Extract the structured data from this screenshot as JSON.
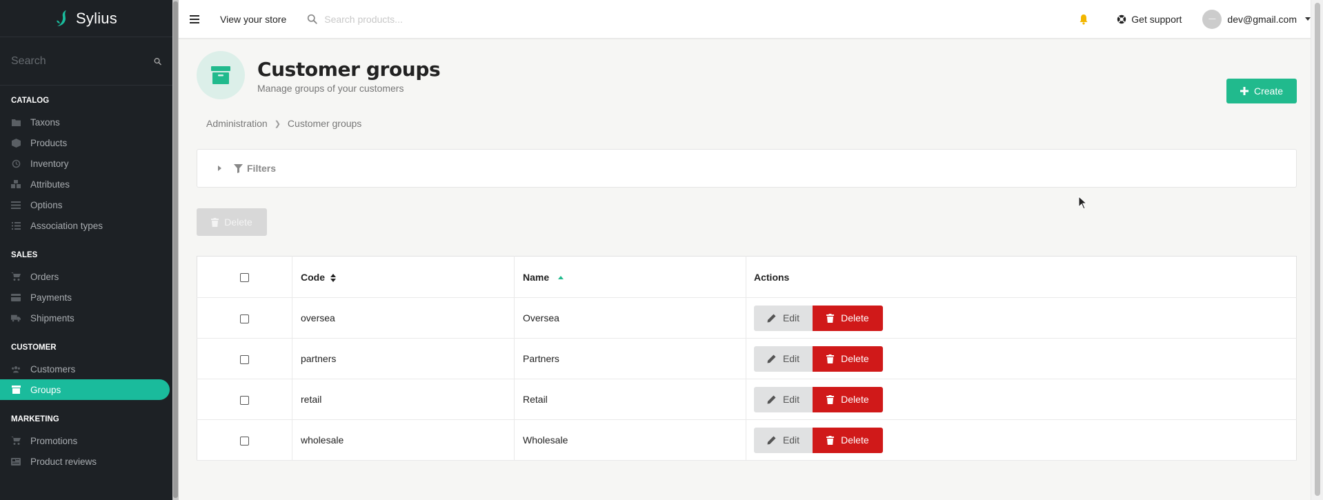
{
  "brand": {
    "name": "Sylius",
    "accent_color": "#1abb9c"
  },
  "sidebar": {
    "search_placeholder": "Search",
    "sections": [
      {
        "title": "CATALOG",
        "items": [
          {
            "label": "Taxons",
            "icon": "folder-icon"
          },
          {
            "label": "Products",
            "icon": "cube-icon"
          },
          {
            "label": "Inventory",
            "icon": "history-icon"
          },
          {
            "label": "Attributes",
            "icon": "cubes-icon"
          },
          {
            "label": "Options",
            "icon": "options-icon"
          },
          {
            "label": "Association types",
            "icon": "list-icon"
          }
        ]
      },
      {
        "title": "SALES",
        "items": [
          {
            "label": "Orders",
            "icon": "cart-icon"
          },
          {
            "label": "Payments",
            "icon": "payment-icon"
          },
          {
            "label": "Shipments",
            "icon": "truck-icon"
          }
        ]
      },
      {
        "title": "CUSTOMER",
        "items": [
          {
            "label": "Customers",
            "icon": "users-icon"
          },
          {
            "label": "Groups",
            "icon": "archive-icon",
            "active": true
          }
        ]
      },
      {
        "title": "MARKETING",
        "items": [
          {
            "label": "Promotions",
            "icon": "cart-icon"
          },
          {
            "label": "Product reviews",
            "icon": "newspaper-icon"
          }
        ]
      }
    ]
  },
  "topbar": {
    "view_store": "View your store",
    "search_placeholder": "Search products...",
    "support": "Get support",
    "user_email": "dev@gmail.com",
    "avatar_text": "—"
  },
  "page": {
    "title": "Customer groups",
    "subtitle": "Manage groups of your customers",
    "create_label": "Create",
    "breadcrumb": [
      "Administration",
      "Customer groups"
    ],
    "filters_label": "Filters",
    "bulk_delete_label": "Delete"
  },
  "table": {
    "headers": {
      "code": "Code",
      "name": "Name",
      "actions": "Actions"
    },
    "edit_label": "Edit",
    "delete_label": "Delete",
    "rows": [
      {
        "code": "oversea",
        "name": "Oversea"
      },
      {
        "code": "partners",
        "name": "Partners"
      },
      {
        "code": "retail",
        "name": "Retail"
      },
      {
        "code": "wholesale",
        "name": "Wholesale"
      }
    ]
  }
}
